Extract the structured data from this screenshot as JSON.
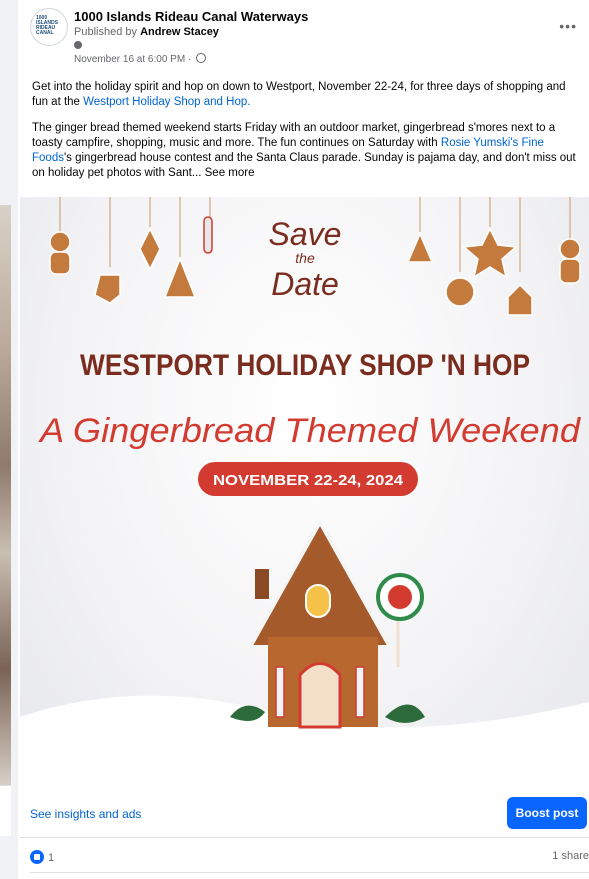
{
  "post": {
    "page_name": "1000 Islands Rideau Canal Waterways",
    "published_prefix": "Published by",
    "published_by": "Andrew Stacey",
    "timestamp": "November 16 at 6:00 PM",
    "logo_text": "1000 ISLANDS RIDEAU CANAL",
    "paragraph1_a": "Get into the holiday spirit and hop on down to Westport, November 22-24, for three days of shopping and fun at the ",
    "paragraph1_link": "Westport Holiday Shop and Hop.",
    "paragraph2_a": "The ginger bread themed weekend starts Friday with an outdoor market, gingerbread s'mores next to a toasty campfire, shopping, music and more. The fun continues on Saturday with ",
    "paragraph2_link": "Rosie Yumski's Fine Foods",
    "paragraph2_b": "'s gingerbread house contest and the Santa Claus parade. Sunday is pajama day, and don't miss out on holiday pet photos with Sant...",
    "see_more": "See more"
  },
  "graphic": {
    "save_line1": "Save",
    "save_line2": "the",
    "save_line3": "Date",
    "headline": "WESTPORT HOLIDAY SHOP 'N HOP",
    "subtitle": "A Gingerbread Themed Weekend",
    "date_badge": "NOVEMBER 22-24, 2024",
    "colors": {
      "headline": "#7a2d1e",
      "subtitle": "#d33b30",
      "badge": "#d33b30",
      "gingerbread": "#c47a3c"
    }
  },
  "footer": {
    "insights_label": "See insights and ads",
    "boost_label": "Boost post",
    "reaction_count": "1",
    "shares_label": "1 share"
  },
  "icons": [
    "more-icon",
    "globe-icon",
    "pin-icon",
    "like-icon"
  ]
}
